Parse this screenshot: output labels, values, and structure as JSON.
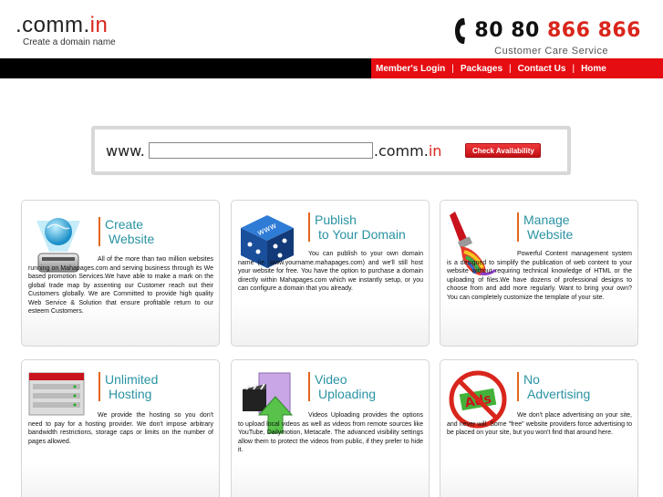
{
  "header": {
    "logo_main": ".comm.",
    "logo_accent": "in",
    "logo_tagline": "Create a domain name",
    "phone_part1": "80 80 ",
    "phone_part2": "866 866",
    "phone_subtitle": "Customer Care Service"
  },
  "nav": {
    "items": [
      "Member's Login",
      "Packages",
      "Contact Us",
      "Home"
    ],
    "separator": "|"
  },
  "search": {
    "prefix": "www.",
    "input_value": "",
    "tld_main": ".comm.",
    "tld_accent": "in",
    "button_label": "Check Availability"
  },
  "cards": [
    {
      "title_line1": "Create",
      "title_line2": "Website",
      "text": "All of the more than two million websites running on Mahapages.com and serving business through its We based promotion Services.We have able to make a mark on the global trade map by assenting our Customer reach out their Customers globally. We are Committed to provide high quality Web Service & Solution that ensure profitable return to our esteem Customers.",
      "icon": "globe-scanner-icon"
    },
    {
      "title_line1": "Publish",
      "title_line2": "to Your Domain",
      "text": "You can publish to your own domain name (ie. www.yourname.mahapages.com) and we'll still host your website for free. You have the option to purchase a domain directly within Mahapages.com which we instantly setup, or you can configure a domain that you already.",
      "icon": "www-dice-icon"
    },
    {
      "title_line1": "Manage",
      "title_line2": "Website",
      "text": "Powerful Content management system is a designed to simplify the publication of web content to your website without requiring technical knowledge of HTML or the uploading of files.We have dozens of professional designs to choose from and add more regularly. Want to bring your own? You can completely customize the template of your site.",
      "icon": "paint-brush-icon"
    },
    {
      "title_line1": "Unlimited",
      "title_line2": "Hosting",
      "text": "We provide the hosting so you don't need to pay for a hosting provider. We don't impose arbitrary bandwidth restrictions, storage caps or limits on the number of pages allowed.",
      "icon": "server-rack-icon"
    },
    {
      "title_line1": "Video",
      "title_line2": "Uploading",
      "text": "Videos Uploading provides the options to upload local videos as well as videos from remote sources like YouTube, Dailymotion, Metacafe. The advanced visibility settings allow them to protect the videos from public, if they prefer to hide it.",
      "icon": "video-upload-icon"
    },
    {
      "title_line1": "No",
      "title_line2": "Advertising",
      "text": "We don't place advertising on your site, and never will. Some \"free\" website providers force advertising to be placed on your site, but you won't find that around here.",
      "icon": "no-ads-icon"
    }
  ],
  "colors": {
    "accent_red": "#e50d12",
    "title_teal": "#2a93a3",
    "title_bar_orange": "#e2651e",
    "nav_black": "#000000"
  }
}
